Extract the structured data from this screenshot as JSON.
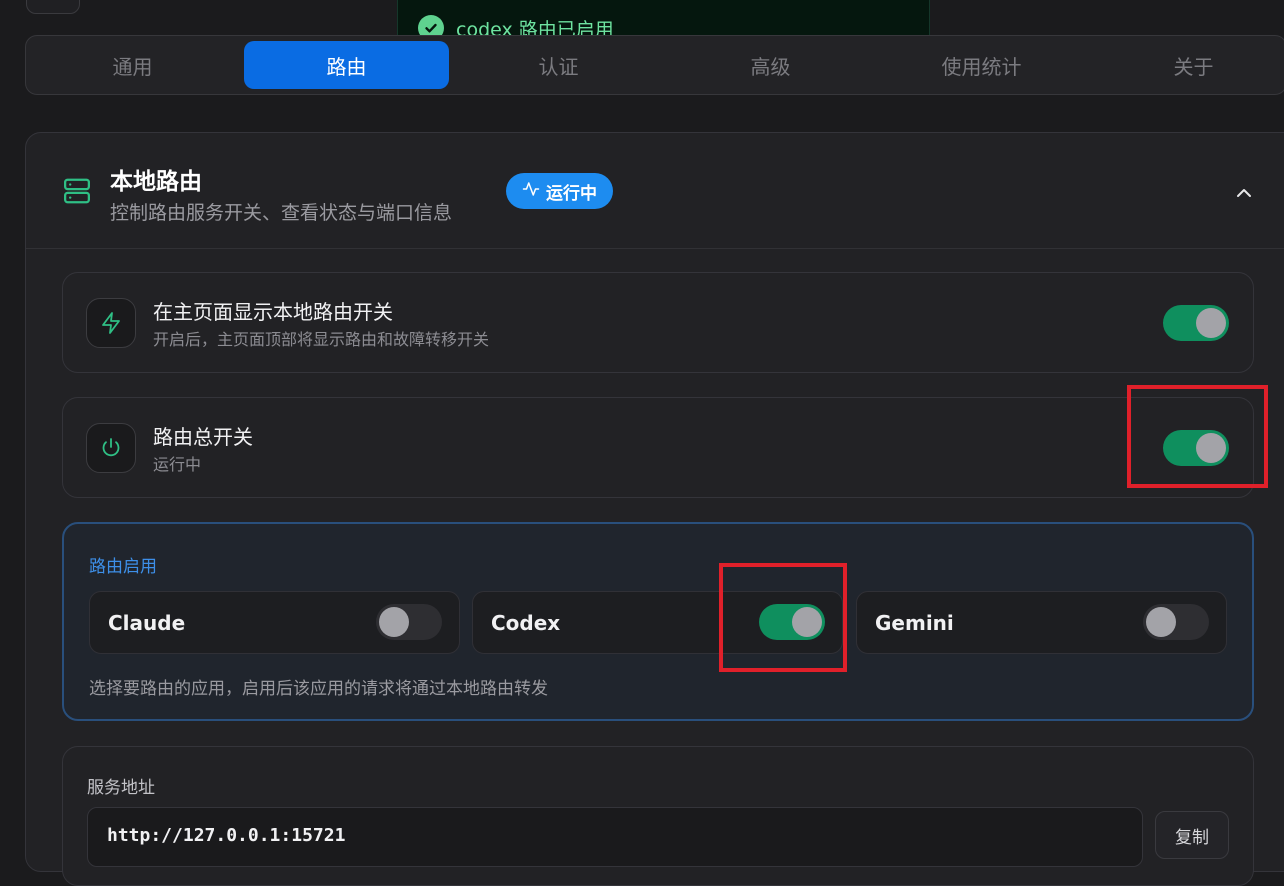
{
  "toast": {
    "message": "codex 路由已启用",
    "icon": "check-circle-icon"
  },
  "tabs": [
    {
      "label": "通用"
    },
    {
      "label": "路由",
      "active": true
    },
    {
      "label": "认证"
    },
    {
      "label": "高级"
    },
    {
      "label": "使用统计"
    },
    {
      "label": "关于"
    }
  ],
  "section": {
    "title": "本地路由",
    "subtitle": "控制路由服务开关、查看状态与端口信息",
    "status_badge": "运行中",
    "icon": "server-icon"
  },
  "settings": {
    "show_on_home": {
      "title": "在主页面显示本地路由开关",
      "desc": "开启后，主页面顶部将显示路由和故障转移开关",
      "enabled": true
    },
    "master_switch": {
      "title": "路由总开关",
      "desc": "运行中",
      "enabled": true
    }
  },
  "routing": {
    "label": "路由启用",
    "apps": [
      {
        "name": "Claude",
        "enabled": false
      },
      {
        "name": "Codex",
        "enabled": true
      },
      {
        "name": "Gemini",
        "enabled": false
      }
    ],
    "hint": "选择要路由的应用，启用后该应用的请求将通过本地路由转发"
  },
  "service": {
    "label": "服务地址",
    "address": "http://127.0.0.1:15721",
    "copy_label": "复制"
  },
  "colors": {
    "accent": "#0a6ce3",
    "toggle_on": "#0f8f5e",
    "success": "#6ee3a0",
    "highlight": "#e0202a"
  }
}
